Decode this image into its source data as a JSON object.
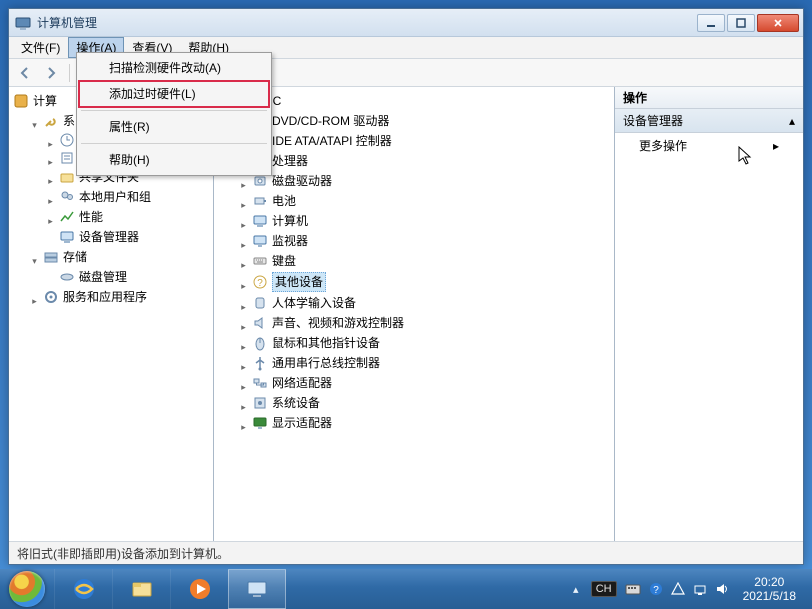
{
  "window": {
    "title": "计算机管理"
  },
  "menubar": {
    "items": [
      "文件(F)",
      "操作(A)",
      "查看(V)",
      "帮助(H)"
    ],
    "active_index": 1
  },
  "context_menu": {
    "items": [
      {
        "label": "扫描检测硬件改动(A)",
        "separator_after": false
      },
      {
        "label": "添加过时硬件(L)",
        "separator_after": true,
        "highlighted": true
      },
      {
        "label": "属性(R)",
        "separator_after": true
      },
      {
        "label": "帮助(H)",
        "separator_after": false
      }
    ]
  },
  "left_tree": {
    "root": "计算机管理(本地)",
    "root_visible_prefix": "计算",
    "nodes": [
      {
        "expander": "▾",
        "indent": 1,
        "icon": "tools-icon",
        "label_visible": "系"
      },
      {
        "expander": "▸",
        "indent": 2,
        "icon": "scheduler-icon",
        "label_visible": ""
      },
      {
        "expander": "▸",
        "indent": 2,
        "icon": "event-icon",
        "label_visible": ""
      },
      {
        "expander": "▸",
        "indent": 2,
        "icon": "folder-share-icon",
        "label": "共享文件夹"
      },
      {
        "expander": "▸",
        "indent": 2,
        "icon": "users-icon",
        "label": "本地用户和组"
      },
      {
        "expander": "▸",
        "indent": 2,
        "icon": "perf-icon",
        "label": "性能"
      },
      {
        "expander": "",
        "indent": 2,
        "icon": "device-mgr-icon",
        "label": "设备管理器"
      },
      {
        "expander": "▾",
        "indent": 1,
        "icon": "storage-icon",
        "label": "存储"
      },
      {
        "expander": "",
        "indent": 2,
        "icon": "disk-mgr-icon",
        "label": "磁盘管理"
      },
      {
        "expander": "▸",
        "indent": 1,
        "icon": "services-icon",
        "label": "服务和应用程序"
      }
    ]
  },
  "device_tree": {
    "root_visible": "n-PC",
    "categories": [
      {
        "label_visible": "DVD/CD-ROM 驱动器",
        "icon": "dvd-icon"
      },
      {
        "label_visible": "IDE ATA/ATAPI 控制器",
        "icon": "ide-icon"
      },
      {
        "label_visible": "处理器",
        "icon": "cpu-icon"
      },
      {
        "label": "磁盘驱动器",
        "icon": "disk-icon"
      },
      {
        "label": "电池",
        "icon": "battery-icon"
      },
      {
        "label": "计算机",
        "icon": "computer-icon"
      },
      {
        "label": "监视器",
        "icon": "monitor-icon"
      },
      {
        "label": "键盘",
        "icon": "keyboard-icon"
      },
      {
        "label": "其他设备",
        "icon": "other-device-icon",
        "selected": true
      },
      {
        "label": "人体学输入设备",
        "icon": "hid-icon"
      },
      {
        "label": "声音、视频和游戏控制器",
        "icon": "sound-icon"
      },
      {
        "label": "鼠标和其他指针设备",
        "icon": "mouse-icon"
      },
      {
        "label": "通用串行总线控制器",
        "icon": "usb-icon"
      },
      {
        "label": "网络适配器",
        "icon": "network-icon"
      },
      {
        "label": "系统设备",
        "icon": "system-icon"
      },
      {
        "label": "显示适配器",
        "icon": "display-icon"
      }
    ]
  },
  "actions_pane": {
    "header": "操作",
    "section": "设备管理器",
    "item": "更多操作"
  },
  "statusbar": {
    "text": "将旧式(非即插即用)设备添加到计算机。"
  },
  "taskbar": {
    "lang": "CH",
    "clock_time": "20:20",
    "clock_date": "2021/5/18"
  }
}
